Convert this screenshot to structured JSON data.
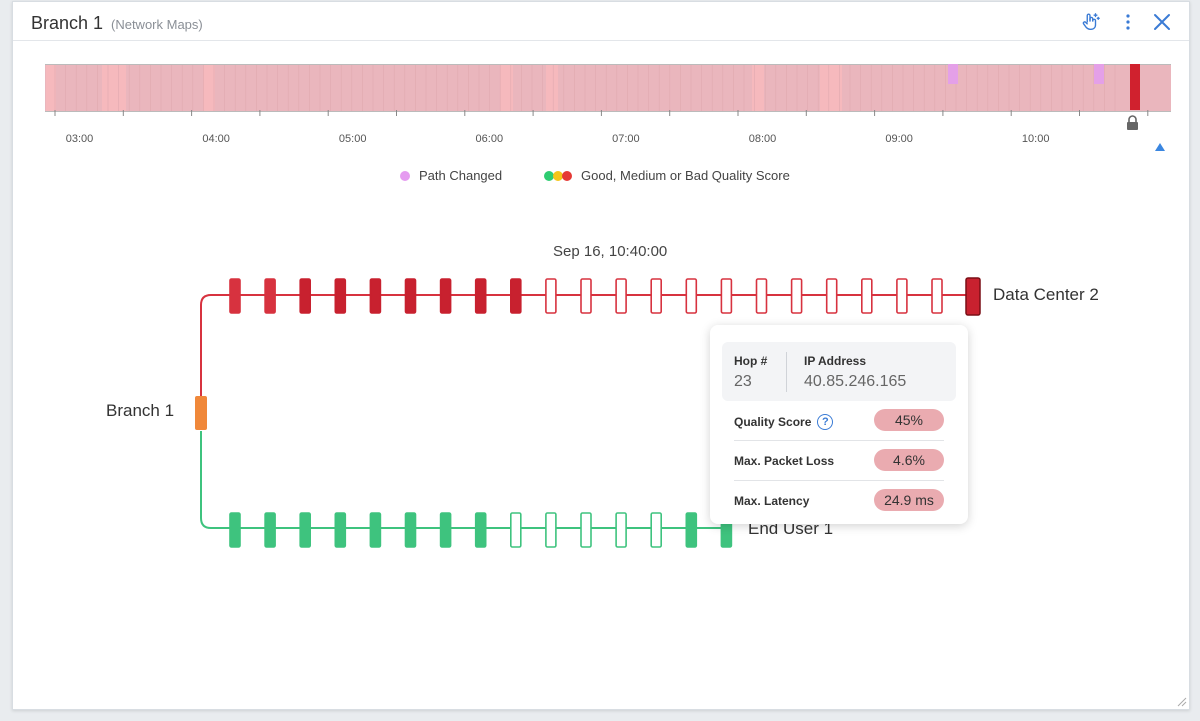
{
  "header": {
    "title": "Branch 1",
    "subtitle": "(Network Maps)",
    "icons": [
      "hand-pointer-icon",
      "more-vertical-icon",
      "close-icon"
    ]
  },
  "timeline": {
    "ticks": [
      "03:00",
      "04:00",
      "05:00",
      "06:00",
      "07:00",
      "08:00",
      "09:00",
      "10:00"
    ],
    "colors": {
      "base": "#eab6bd",
      "light": "#f6b9bd",
      "path_changed": "#e4a0e8",
      "bad": "#d0212e",
      "lock": "#666666",
      "marker": "#3a86e0"
    },
    "icons": [
      "lock-icon",
      "triangle-up-icon"
    ]
  },
  "legend": {
    "path_changed": "Path Changed",
    "quality": "Good, Medium or Bad Quality Score",
    "colors": {
      "good": "#2ecc71",
      "medium": "#f5c518",
      "bad": "#e53935",
      "path": "#e59bf0"
    }
  },
  "map": {
    "timestamp": "Sep 16, 10:40:00",
    "source": "Branch 1",
    "destinations": [
      "Data Center 2",
      "End User 1"
    ],
    "colors": {
      "red": "#d7323f",
      "dark_red": "#c8212f",
      "green": "#3ec37e",
      "orange": "#f0883a"
    }
  },
  "tooltip": {
    "hop_label": "Hop #",
    "hop_value": "23",
    "ip_label": "IP Address",
    "ip_value": "40.85.246.165",
    "rows": [
      {
        "label": "Quality Score",
        "value": "45%"
      },
      {
        "label": "Max. Packet Loss",
        "value": "4.6%"
      },
      {
        "label": "Max. Latency",
        "value": "24.9 ms"
      }
    ]
  }
}
